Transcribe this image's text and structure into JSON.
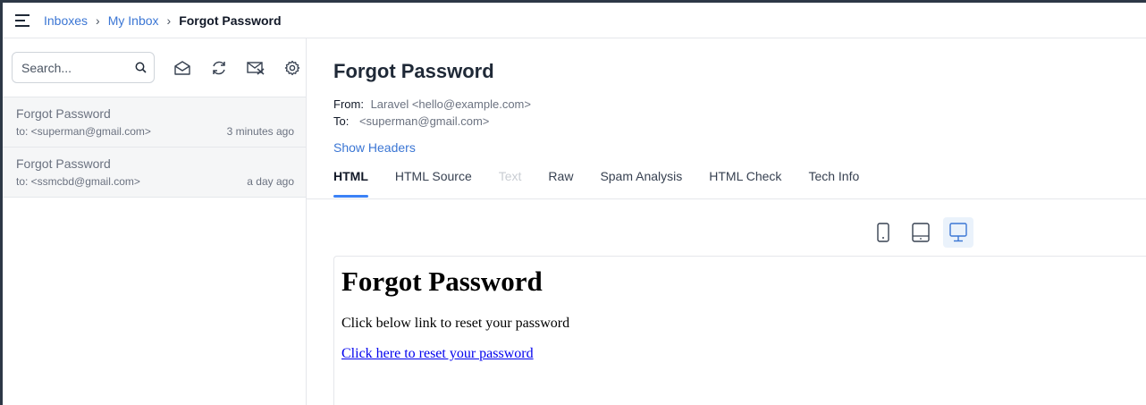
{
  "breadcrumb": {
    "inboxes": "Inboxes",
    "my_inbox": "My Inbox",
    "current": "Forgot Password",
    "separator": "›"
  },
  "search": {
    "placeholder": "Search..."
  },
  "toolbar_icons": [
    "mark-read-icon",
    "refresh-icon",
    "clear-inbox-icon",
    "settings-icon"
  ],
  "messages": [
    {
      "subject": "Forgot Password",
      "to": "to: <superman@gmail.com>",
      "time": "3 minutes ago"
    },
    {
      "subject": "Forgot Password",
      "to": "to: <ssmcbd@gmail.com>",
      "time": "a day ago"
    }
  ],
  "mail": {
    "title": "Forgot Password",
    "from_label": "From:",
    "from_value": "Laravel <hello@example.com>",
    "to_label": "To:",
    "to_value": "<superman@gmail.com>",
    "show_headers": "Show Headers"
  },
  "tabs": [
    {
      "label": "HTML",
      "state": "active"
    },
    {
      "label": "HTML Source",
      "state": "normal"
    },
    {
      "label": "Text",
      "state": "disabled"
    },
    {
      "label": "Raw",
      "state": "normal"
    },
    {
      "label": "Spam Analysis",
      "state": "normal"
    },
    {
      "label": "HTML Check",
      "state": "normal"
    },
    {
      "label": "Tech Info",
      "state": "normal"
    }
  ],
  "view_modes": [
    "phone-view-icon",
    "tablet-view-icon",
    "desktop-view-icon"
  ],
  "preview": {
    "heading": "Forgot Password",
    "body": "Click below link to reset your password",
    "link": "Click here to reset your password"
  },
  "colors": {
    "link": "#3b76d4",
    "tab_indicator": "#3b82f6",
    "active_view_bg": "#eaf2fb"
  }
}
